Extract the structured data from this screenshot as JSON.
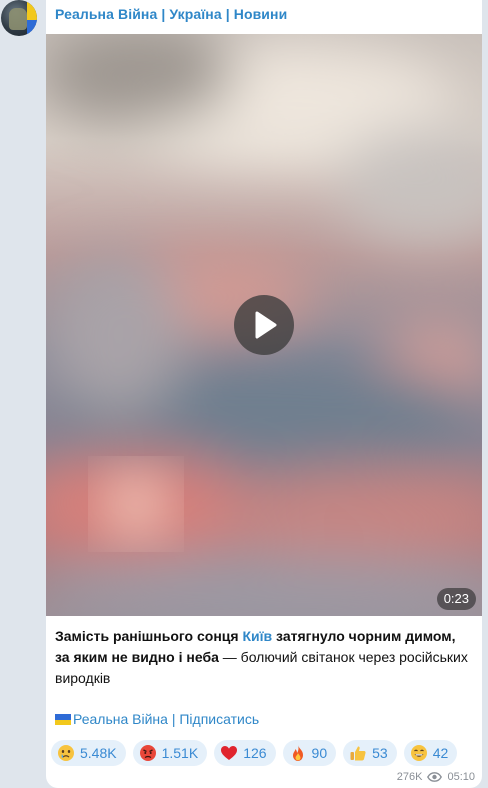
{
  "channel": {
    "name": "Реальна Війна | Україна | Новини"
  },
  "video": {
    "duration": "0:23"
  },
  "caption": {
    "part1": "Замість ранішнього сонця ",
    "link": "Київ",
    "part2": " затягнуло чорним димом, за яким не видно і неба",
    "part3": " — болючий світанок через російських виродків"
  },
  "subscribe": {
    "label": "Реальна Війна | Підписатись"
  },
  "reactions": [
    {
      "emoji": "crying-face-icon",
      "count": "5.48K"
    },
    {
      "emoji": "angry-face-icon",
      "count": "1.51K"
    },
    {
      "emoji": "red-heart-icon",
      "count": "126"
    },
    {
      "emoji": "fire-icon",
      "count": "90"
    },
    {
      "emoji": "thumbs-up-icon",
      "count": "53"
    },
    {
      "emoji": "grinning-face-icon",
      "count": "42"
    }
  ],
  "meta": {
    "views": "276K",
    "time": "05:10"
  },
  "colors": {
    "accent": "#2f87c8",
    "reaction_bg": "#e5f0fa",
    "background": "#dfe5ec"
  }
}
